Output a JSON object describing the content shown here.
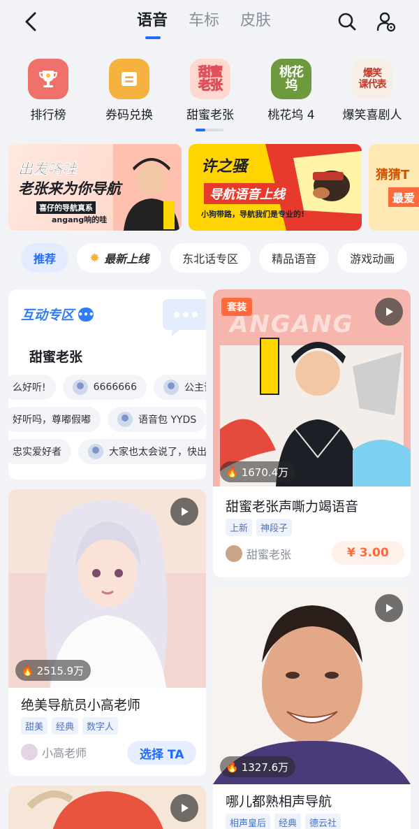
{
  "header": {
    "tabs": [
      "语音",
      "车标",
      "皮肤"
    ],
    "active_tab": 0
  },
  "quick_entries": [
    {
      "label": "排行榜",
      "icon": "trophy-icon",
      "color": "#f0706b"
    },
    {
      "label": "券码兑换",
      "icon": "ticket-icon",
      "color": "#f5b23f"
    },
    {
      "label": "甜蜜老张",
      "icon": "tianmi-laozhang-logo",
      "art": "甜蜜\n老张"
    },
    {
      "label": "桃花坞 4",
      "icon": "taohuawu-logo",
      "art": "桃花\n坞"
    },
    {
      "label": "爆笑喜剧人",
      "icon": "baoxiao-logo",
      "art": "爆笑\n课代表"
    }
  ],
  "banners": [
    {
      "title_line1": "出发咯哇",
      "title_line2": "老张来为你导航",
      "sub1": "喜仔的导航真系",
      "sub2": "angang响的哇"
    },
    {
      "title_line1": "许之骚",
      "title_line2": "导航语音上线",
      "sub1": "小狗带路，导航我们是专业的!"
    },
    {
      "title_line1": "猜猜T",
      "title_line2": "最爱"
    }
  ],
  "categories": [
    "推荐",
    "最新上线",
    "东北话专区",
    "精品语音",
    "游戏动画"
  ],
  "interaction": {
    "title": "互动专区",
    "name": "甜蜜老张",
    "rows": [
      [
        {
          "text": "么好听!",
          "avatar": false
        },
        {
          "text": "6666666",
          "avatar": true
        },
        {
          "text": "公主请",
          "avatar": true
        }
      ],
      [
        {
          "text": "好听吗，尊嘟假嘟",
          "avatar": false
        },
        {
          "text": "语音包 YYDS",
          "avatar": true
        }
      ],
      [
        {
          "text": "忠实爱好者",
          "avatar": false
        },
        {
          "text": "大家也太会说了，快出",
          "avatar": true
        }
      ]
    ]
  },
  "cards": {
    "laozhang": {
      "badge": "套装",
      "heat": "1670.4万",
      "title": "甜蜜老张声嘶力竭语音",
      "tags": [
        "上新",
        "神段子"
      ],
      "author": "甜蜜老张",
      "price": "¥ 3.00",
      "watermark": "ANGANG"
    },
    "xiaogao": {
      "heat": "2515.9万",
      "title": "绝美导航员小高老师",
      "tags": [
        "甜美",
        "经典",
        "数字人"
      ],
      "author": "小高老师",
      "button": "选择 TA"
    },
    "guodegang": {
      "heat": "1327.6万",
      "title": "哪儿都熟相声导航",
      "tags": [
        "相声皇后",
        "经典",
        "德云社"
      ]
    }
  },
  "colors": {
    "accent": "#1f6bff",
    "price": "#ff6a3d",
    "background": "#f2f3f7"
  }
}
